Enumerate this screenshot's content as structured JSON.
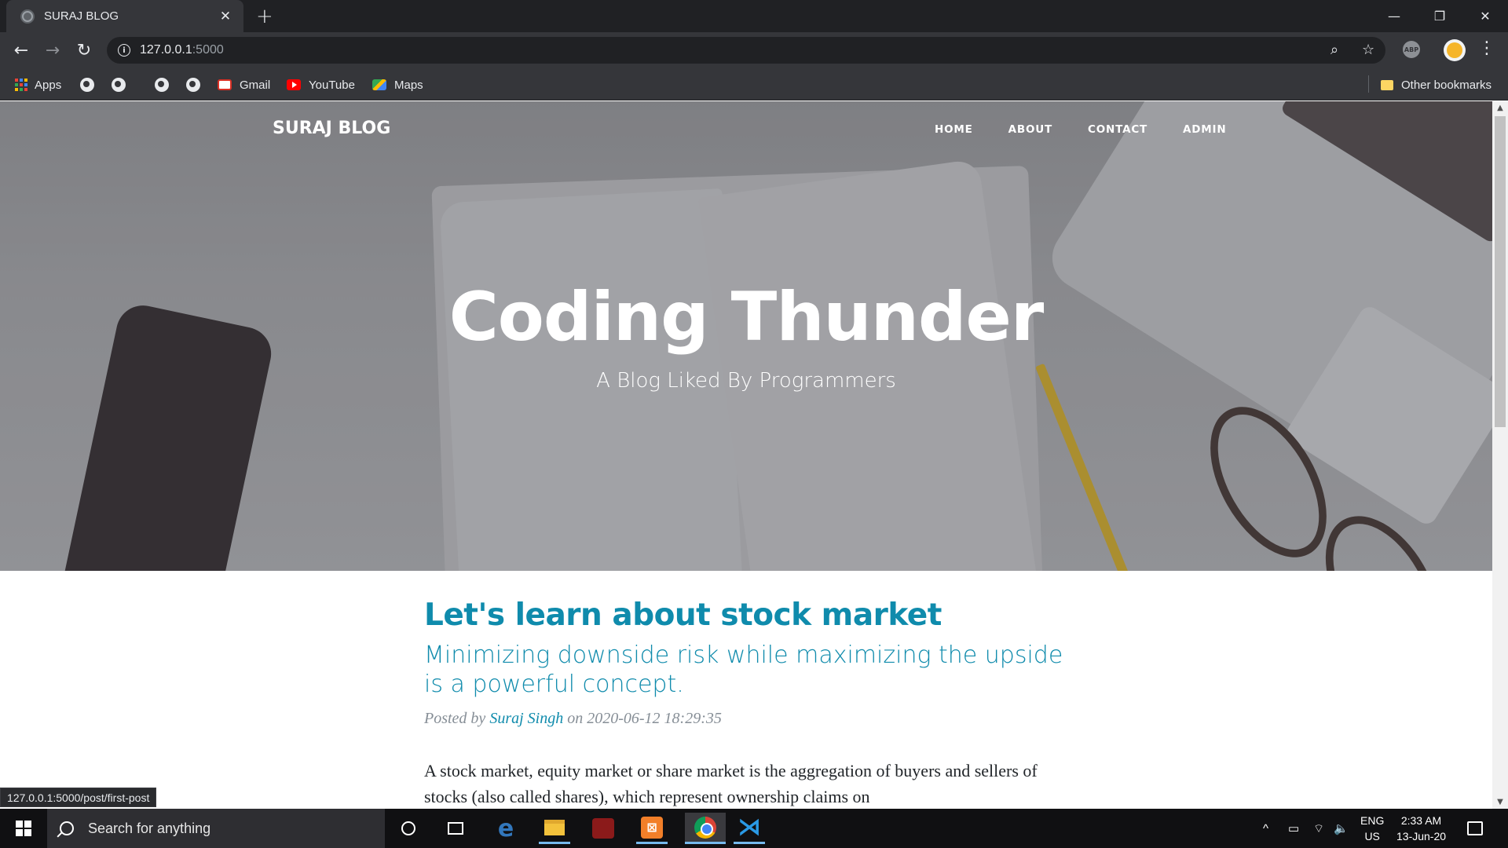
{
  "browser": {
    "tab_title": "SURAJ BLOG",
    "tab_close": "✕",
    "new_tab": "+",
    "window_controls": [
      "—",
      "❐",
      "✕"
    ],
    "url_host": "127.0.0.1",
    "url_port": ":5000",
    "bookmarks": {
      "apps": "Apps",
      "gmail": "Gmail",
      "youtube": "YouTube",
      "maps": "Maps",
      "other": "Other bookmarks"
    },
    "status_url": "127.0.0.1:5000/post/first-post"
  },
  "site": {
    "brand": "SURAJ BLOG",
    "nav": [
      "HOME",
      "ABOUT",
      "CONTACT",
      "ADMIN"
    ],
    "hero_title": "Coding Thunder",
    "hero_subtitle": "A Blog Liked By Programmers"
  },
  "post": {
    "title": "Let's learn about stock market",
    "subtitle": "Minimizing downside risk while maximizing the upside is a powerful concept.",
    "meta_prefix": "Posted by",
    "author": "Suraj Singh",
    "meta_on": "on",
    "date": "2020-06-12 18:29:35",
    "body": "A stock market, equity market or share market is the aggregation of buyers and sellers of stocks (also called shares), which represent ownership claims on"
  },
  "taskbar": {
    "search_placeholder": "Search for anything",
    "lang": "ENG",
    "region": "US",
    "time": "2:33 AM",
    "date": "13-Jun-20"
  },
  "colors": {
    "accent": "#0f8bac",
    "chrome_dark": "#202124",
    "chrome_toolbar": "#35363a"
  }
}
